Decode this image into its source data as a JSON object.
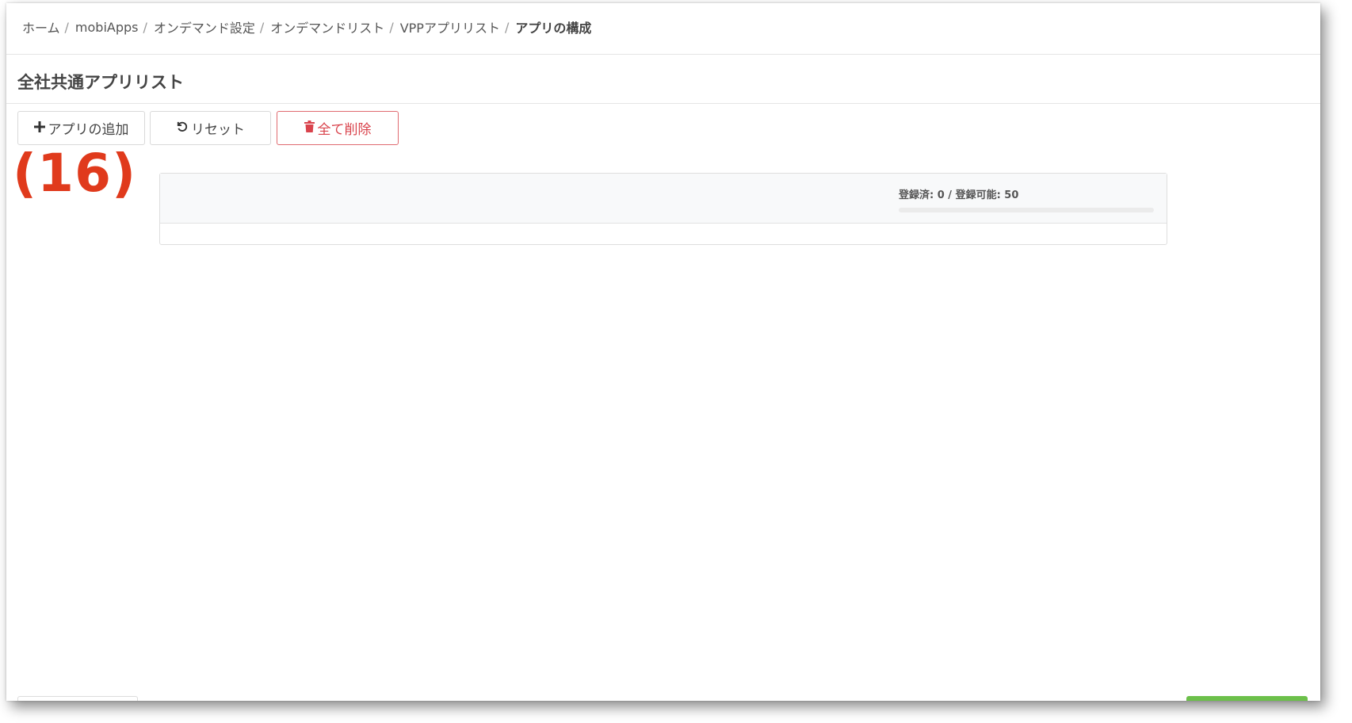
{
  "breadcrumb": {
    "items": [
      "ホーム",
      "mobiApps",
      "オンデマンド設定",
      "オンデマンドリスト",
      "VPPアプリリスト",
      "アプリの構成"
    ],
    "separator": "/"
  },
  "page_title": "全社共通アプリリスト",
  "toolbar": {
    "add_label": "アプリの追加",
    "reset_label": "リセット",
    "delete_all_label": "全て削除"
  },
  "annotation": "(16)",
  "quota": {
    "text": "登録済: 0 / 登録可能: 50",
    "registered": 0,
    "capacity": 50,
    "fill_fraction": 0
  },
  "colors": {
    "danger": "#d9434c",
    "annotation": "#e03a1c",
    "success": "#6cc04a"
  },
  "icons": {
    "add": "plus-icon",
    "reset": "rotate-left-icon",
    "delete": "trash-icon"
  }
}
